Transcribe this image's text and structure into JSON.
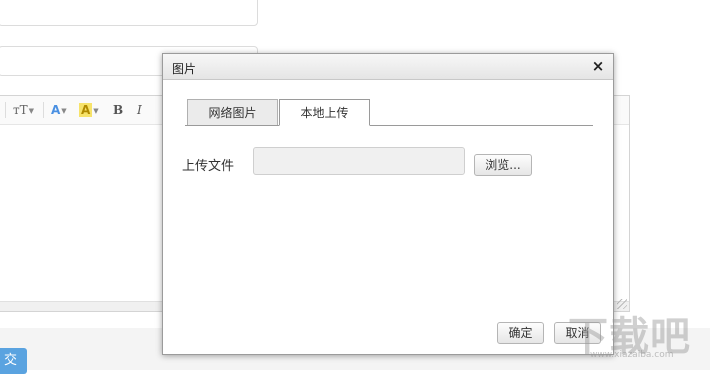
{
  "editor": {
    "toolbar": {
      "font_size_label": "тT",
      "font_color_label": "A",
      "bg_color_label": "A",
      "bold_label": "B",
      "italic_label": "I"
    },
    "submit_partial_label": "交"
  },
  "dialog": {
    "title": "图片",
    "close_glyph": "×",
    "tabs": [
      {
        "label": "网络图片",
        "active": false
      },
      {
        "label": "本地上传",
        "active": true
      }
    ],
    "upload": {
      "label": "上传文件",
      "path_value": "",
      "browse_label": "浏览..."
    },
    "buttons": {
      "ok_label": "确定",
      "cancel_label": "取消"
    }
  },
  "watermark": {
    "big_text": "下载吧",
    "small_text": "www.xiazaiba.com"
  },
  "colors": {
    "dialog_border": "#9b9b9b",
    "active_tab_bg": "#ffffff",
    "inactive_tab_bg": "#ebebeb",
    "submit_button": "#5aa3e0",
    "font_color_icon": "#4a90e2",
    "highlight_icon": "#f7e36a"
  }
}
